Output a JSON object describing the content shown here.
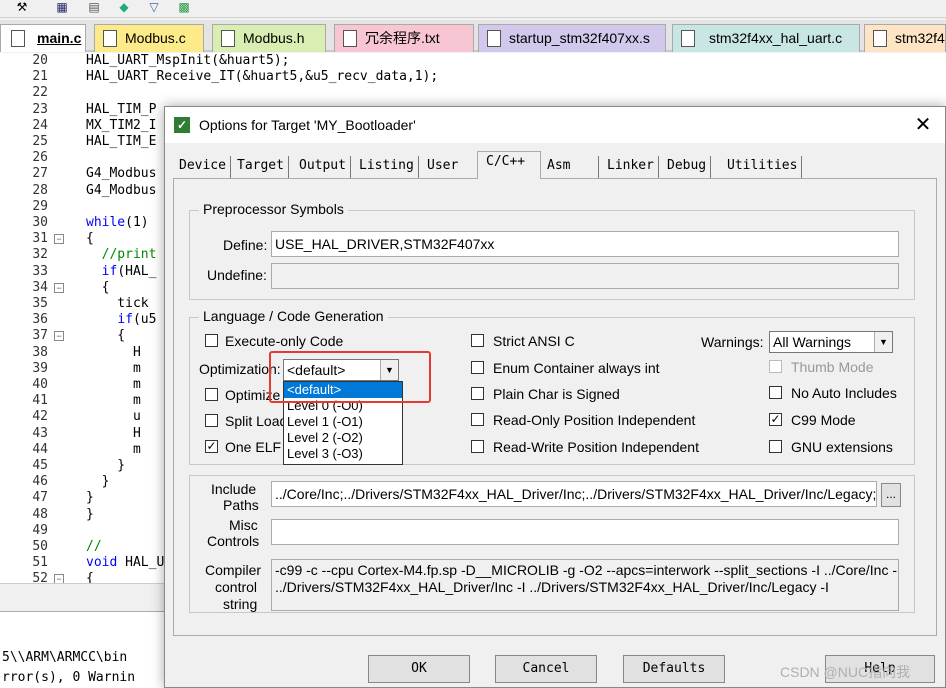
{
  "tabs": [
    {
      "label": "main.c",
      "active": true
    },
    {
      "label": "Modbus.c"
    },
    {
      "label": "Modbus.h"
    },
    {
      "label": "冗余程序.txt"
    },
    {
      "label": "startup_stm32f407xx.s"
    },
    {
      "label": "stm32f4xx_hal_uart.c"
    },
    {
      "label": "stm32f4"
    }
  ],
  "code": [
    {
      "n": "20",
      "t": "HAL_UART_MspInit(&huart5);"
    },
    {
      "n": "21",
      "t": "HAL_UART_Receive_IT(&huart5,&u5_recv_data,1);"
    },
    {
      "n": "22",
      "t": ""
    },
    {
      "n": "23",
      "t": "HAL_TIM_P"
    },
    {
      "n": "24",
      "t": "MX_TIM2_I"
    },
    {
      "n": "25",
      "t": "HAL_TIM_E"
    },
    {
      "n": "26",
      "t": ""
    },
    {
      "n": "27",
      "t": "G4_Modbus"
    },
    {
      "n": "28",
      "t": "G4_Modbus"
    },
    {
      "n": "29",
      "t": ""
    },
    {
      "n": "30",
      "t": "while(1)"
    },
    {
      "n": "31",
      "t": "{"
    },
    {
      "n": "32",
      "t": "  //print"
    },
    {
      "n": "33",
      "t": "  if(HAL_"
    },
    {
      "n": "34",
      "t": "  {"
    },
    {
      "n": "35",
      "t": "    tick"
    },
    {
      "n": "36",
      "t": "    if(u5"
    },
    {
      "n": "37",
      "t": "    {"
    },
    {
      "n": "38",
      "t": "      H"
    },
    {
      "n": "39",
      "t": "      m"
    },
    {
      "n": "40",
      "t": "      m"
    },
    {
      "n": "41",
      "t": "      m"
    },
    {
      "n": "42",
      "t": "      u"
    },
    {
      "n": "43",
      "t": "      H"
    },
    {
      "n": "44",
      "t": "      m"
    },
    {
      "n": "45",
      "t": "    }"
    },
    {
      "n": "46",
      "t": "  }"
    },
    {
      "n": "47",
      "t": "}"
    },
    {
      "n": "48",
      "t": "}"
    },
    {
      "n": "49",
      "t": ""
    },
    {
      "n": "50",
      "t": "//"
    },
    {
      "n": "51",
      "t": "void HAL_UA"
    },
    {
      "n": "52",
      "t": "{"
    }
  ],
  "build": {
    "line1": "5\\\\ARM\\ARMCC\\bin",
    "line2": "rror(s), 0 Warnin"
  },
  "dialog": {
    "title": "Options for Target 'MY_Bootloader'",
    "tabs": [
      "Device",
      "Target",
      "Output",
      "Listing",
      "User",
      "C/C++",
      "Asm",
      "Linker",
      "Debug",
      "Utilities"
    ],
    "preprocessor": {
      "group": "Preprocessor Symbols",
      "define_label": "Define:",
      "define_value": "USE_HAL_DRIVER,STM32F407xx",
      "undefine_label": "Undefine:",
      "undefine_value": ""
    },
    "language": {
      "group": "Language / Code Generation",
      "execute_only": {
        "label": "Execute-only Code",
        "checked": false
      },
      "optimization_label": "Optimization:",
      "optimization_value": "<default>",
      "optimization_options": [
        "<default>",
        "Level 0 (-O0)",
        "Level 1 (-O1)",
        "Level 2 (-O2)",
        "Level 3 (-O3)"
      ],
      "optimize_time": {
        "label": "Optimize f",
        "checked": false
      },
      "split_load": {
        "label": "Split Load",
        "checked": false
      },
      "one_elf": {
        "label": "One ELF",
        "checked": true
      },
      "strict_ansi": {
        "label": "Strict ANSI C",
        "checked": false
      },
      "enum_container": {
        "label": "Enum Container always int",
        "checked": false
      },
      "plain_char": {
        "label": "Plain Char is Signed",
        "checked": false
      },
      "ro_pi": {
        "label": "Read-Only Position Independent",
        "checked": false
      },
      "rw_pi": {
        "label": "Read-Write Position Independent",
        "checked": false
      },
      "warnings_label": "Warnings:",
      "warnings_value": "All Warnings",
      "thumb_mode": {
        "label": "Thumb Mode",
        "checked": false
      },
      "no_auto_includes": {
        "label": "No Auto Includes",
        "checked": false
      },
      "c99": {
        "label": "C99 Mode",
        "checked": true
      },
      "gnu_ext": {
        "label": "GNU extensions",
        "checked": false
      }
    },
    "include": {
      "include_label_1": "Include",
      "include_label_2": "Paths",
      "include_value": "../Core/Inc;../Drivers/STM32F4xx_HAL_Driver/Inc;../Drivers/STM32F4xx_HAL_Driver/Inc/Legacy;",
      "browse": "...",
      "misc_label_1": "Misc",
      "misc_label_2": "Controls",
      "misc_value": "",
      "compiler_label_1": "Compiler",
      "compiler_label_2": "control",
      "compiler_label_3": "string",
      "compiler_line1": "-c99 -c --cpu Cortex-M4.fp.sp -D__MICROLIB -g -O2 --apcs=interwork --split_sections -I ../Core/Inc -I",
      "compiler_line2": "../Drivers/STM32F4xx_HAL_Driver/Inc -I ../Drivers/STM32F4xx_HAL_Driver/Inc/Legacy -I"
    },
    "buttons": {
      "ok": "OK",
      "cancel": "Cancel",
      "defaults": "Defaults",
      "help": "Help"
    }
  },
  "watermark": "CSDN @NUC指向我"
}
